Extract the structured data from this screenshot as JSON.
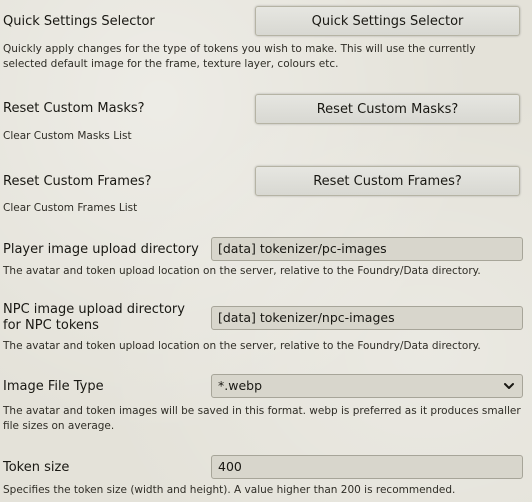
{
  "settings": {
    "quick": {
      "label": "Quick Settings Selector",
      "button": "Quick Settings Selector",
      "hint": "Quickly apply changes for the type of tokens you wish to make. This will use the currently selected default image for the frame, texture layer, colours etc."
    },
    "masks": {
      "label": "Reset Custom Masks?",
      "button": "Reset Custom Masks?",
      "hint": "Clear Custom Masks List"
    },
    "frames": {
      "label": "Reset Custom Frames?",
      "button": "Reset Custom Frames?",
      "hint": "Clear Custom Frames List"
    },
    "player_dir": {
      "label": "Player image upload directory",
      "value": "[data] tokenizer/pc-images",
      "hint": "The avatar and token upload location on the server, relative to the Foundry/Data directory."
    },
    "npc_dir": {
      "label": "NPC image upload directory for NPC tokens",
      "value": "[data] tokenizer/npc-images",
      "hint": "The avatar and token upload location on the server, relative to the Foundry/Data directory."
    },
    "file_type": {
      "label": "Image File Type",
      "selected": "*.webp",
      "hint": "The avatar and token images will be saved in this format. webp is preferred as it produces smaller file sizes on average."
    },
    "token_size": {
      "label": "Token size",
      "value": "400",
      "hint": "Specifies the token size (width and height). A value higher than 200 is recommended."
    }
  },
  "icons": {
    "select_arrow": "chevron-down-icon"
  }
}
